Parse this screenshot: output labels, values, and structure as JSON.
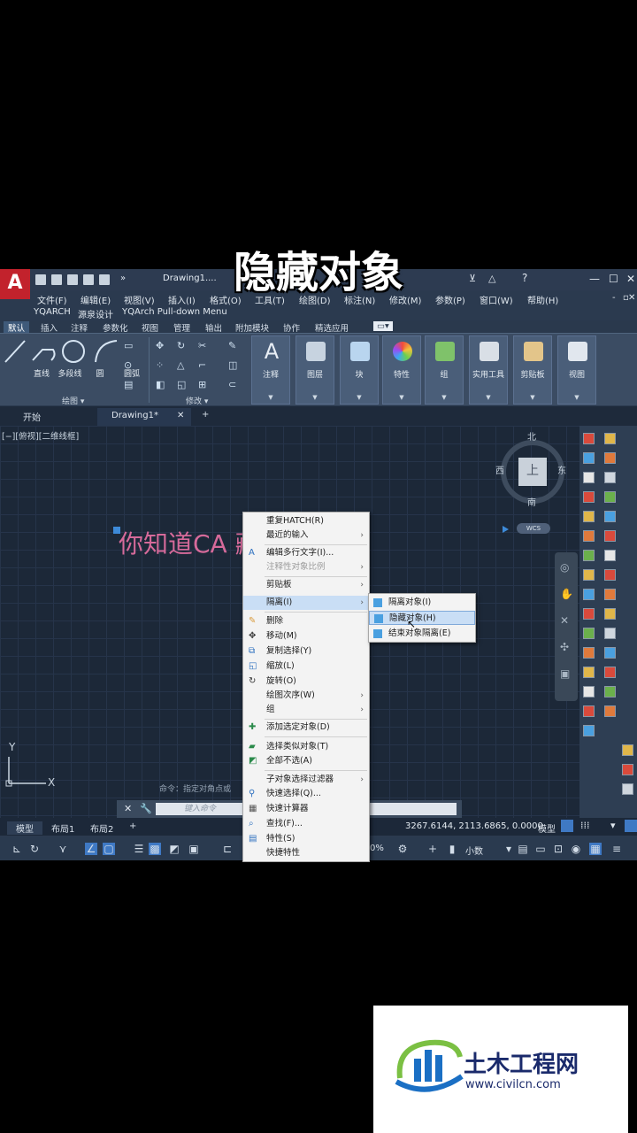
{
  "overlay_title": "隐藏对象",
  "app": {
    "logo": "A",
    "doc_title": "Drawing1....",
    "menus": [
      "文件(F)",
      "编辑(E)",
      "视图(V)",
      "插入(I)",
      "格式(O)",
      "工具(T)",
      "绘图(D)",
      "标注(N)",
      "修改(M)",
      "参数(P)",
      "窗口(W)",
      "帮助(H)"
    ],
    "submenus": [
      "YQARCH",
      "源泉设计",
      "YQArch Pull-down Menu"
    ],
    "ribbon_tabs": [
      "默认",
      "插入",
      "注释",
      "参数化",
      "视图",
      "管理",
      "输出",
      "附加模块",
      "协作",
      "精选应用"
    ],
    "draw_tools": [
      "直线",
      "多段线",
      "圆",
      "圆弧"
    ],
    "group_draw": "绘图 ▾",
    "group_modify": "修改 ▾",
    "big_buttons": [
      {
        "label": "注释",
        "color": "#e8eef5"
      },
      {
        "label": "图层",
        "color": "#c7d3e0"
      },
      {
        "label": "块",
        "color": "#b9d5ef"
      },
      {
        "label": "特性",
        "color": "#f2a93b"
      },
      {
        "label": "组",
        "color": "#7fc26a"
      },
      {
        "label": "实用工具",
        "color": "#d9dfe6"
      },
      {
        "label": "剪贴板",
        "color": "#e3c58a"
      },
      {
        "label": "视图",
        "color": "#e1e7ee"
      }
    ],
    "file_tabs": {
      "start": "开始",
      "drawing": "Drawing1*",
      "close": "✕",
      "add": "+"
    },
    "viewport_label": "[−][俯视][二维线框]",
    "canvas_text": "你知道CA          藏对象吗？",
    "compass": {
      "north": "北",
      "south": "南",
      "east": "东",
      "west": "西",
      "top": "上",
      "wcs": "WCS"
    },
    "ucs": {
      "x": "X",
      "y": "Y"
    },
    "command": {
      "hint": "命令：指定对角点或",
      "placeholder": "键入命令"
    },
    "layout_tabs": [
      "模型",
      "布局1",
      "布局2",
      "+"
    ],
    "coords": "3267.6144, 2113.6865, 0.0000",
    "status": {
      "model": "模型",
      "zoom": "0%",
      "units": "小数"
    }
  },
  "context_menu": {
    "items": [
      {
        "label": "重复HATCH(R)",
        "sub": false
      },
      {
        "label": "最近的输入",
        "sub": true
      },
      {
        "label": "编辑多行文字(I)...",
        "sub": false
      },
      {
        "label": "注释性对象比例",
        "sub": true,
        "disabled": true
      },
      {
        "label": "剪贴板",
        "sub": true
      },
      {
        "label": "隔离(I)",
        "sub": true,
        "highlight": true
      },
      {
        "label": "删除",
        "sub": false
      },
      {
        "label": "移动(M)",
        "sub": false
      },
      {
        "label": "复制选择(Y)",
        "sub": false
      },
      {
        "label": "缩放(L)",
        "sub": false
      },
      {
        "label": "旋转(O)",
        "sub": false
      },
      {
        "label": "绘图次序(W)",
        "sub": true
      },
      {
        "label": "组",
        "sub": true
      },
      {
        "label": "添加选定对象(D)",
        "sub": false
      },
      {
        "label": "选择类似对象(T)",
        "sub": false
      },
      {
        "label": "全部不选(A)",
        "sub": false
      },
      {
        "label": "子对象选择过滤器",
        "sub": true
      },
      {
        "label": "快速选择(Q)...",
        "sub": false
      },
      {
        "label": "快速计算器",
        "sub": false
      },
      {
        "label": "查找(F)...",
        "sub": false
      },
      {
        "label": "特性(S)",
        "sub": false
      },
      {
        "label": "快捷特性",
        "sub": false
      }
    ]
  },
  "isolate_submenu": {
    "items": [
      {
        "label": "隔离对象(I)",
        "highlight": false
      },
      {
        "label": "隐藏对象(H)",
        "highlight": true
      },
      {
        "label": "结束对象隔离(E)",
        "highlight": false
      }
    ]
  },
  "watermark": {
    "name": "土木工程网",
    "url": "www.civilcn.com"
  }
}
